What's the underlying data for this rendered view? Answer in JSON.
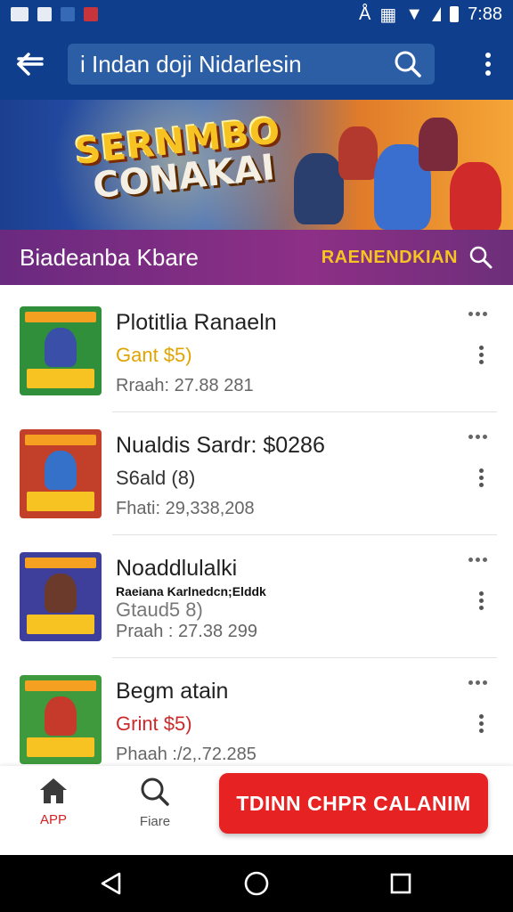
{
  "status_bar": {
    "time": "7:88",
    "icons": [
      "image-icon",
      "notification-icon",
      "app-icon",
      "chrome-icon",
      "bluetooth-icon",
      "vibrate-icon",
      "wifi-icon",
      "signal-icon",
      "battery-icon"
    ]
  },
  "app_bar": {
    "search_text": "i Indan doji Nidarlesin",
    "back_icon": "back-arrow-icon",
    "search_icon": "search-icon",
    "menu_icon": "overflow-menu-icon"
  },
  "banner": {
    "logo_line1": "SERNMBO",
    "logo_line2": "CONAKAI"
  },
  "section": {
    "title": "Biadeanba Kbare",
    "promo": "RAENENDKIAN"
  },
  "items": [
    {
      "title": "Plotitlia Ranaeln",
      "subtitle": "Gant $5)",
      "subtitle_color": "#e0a400",
      "extra": "",
      "meta": "Rraah: 27.88 281",
      "thumb_bg": "#2f8f3a",
      "hero_color": "#3a4fa8"
    },
    {
      "title": "Nualdis Sardr: $0286",
      "subtitle": "S6ald (8)",
      "subtitle_color": "#333333",
      "extra": "",
      "meta": "Fhati: 29,338,208",
      "thumb_bg": "#c2402a",
      "hero_color": "#3570c9"
    },
    {
      "title": "Noaddlulalki",
      "subtitle": "Gtaud5 8)",
      "subtitle_color": "#777777",
      "extra": "Raeiana Karlnedcn;Elddk",
      "meta": "Praah : 27.38 299",
      "thumb_bg": "#3d3f9a",
      "hero_color": "#6b3a2a"
    },
    {
      "title": "Begm atain",
      "subtitle": "Grint $5)",
      "subtitle_color": "#cc2a2a",
      "extra": "",
      "meta": "Phaah :/2,.72.285",
      "thumb_bg": "#3e9a3c",
      "hero_color": "#c53a2a"
    }
  ],
  "bottom_bar": {
    "tab_app_label": "APP",
    "tab_app_color": "#d22222",
    "tab_search_label": "Fiare",
    "cta_label": "TDINN CHPR CALANIM"
  },
  "nav": [
    "back-triangle-icon",
    "home-circle-icon",
    "recents-square-icon"
  ]
}
